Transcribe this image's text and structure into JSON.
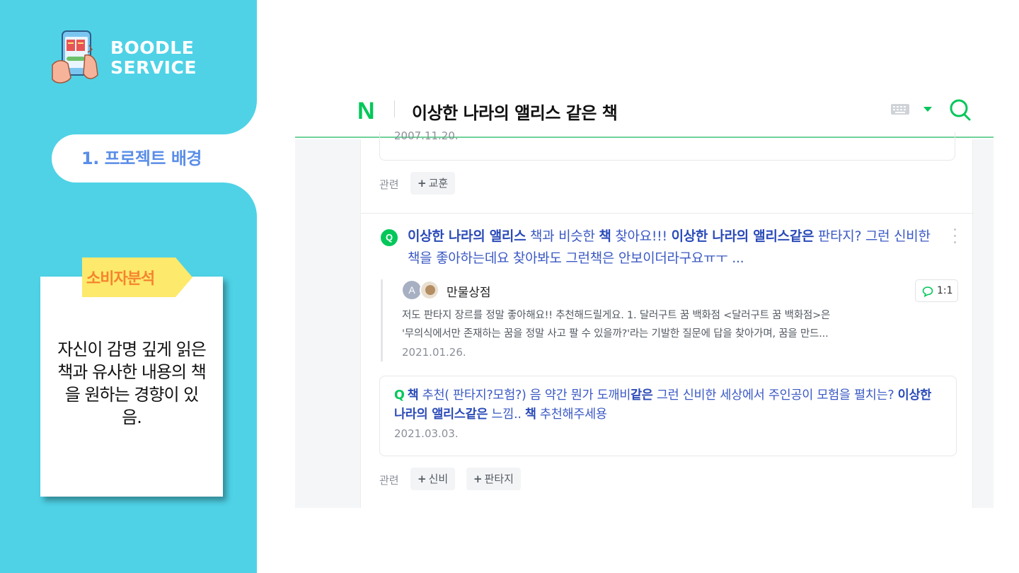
{
  "brand": {
    "line1": "BOODLE",
    "line2": "SERVICE"
  },
  "section_tab": {
    "label": "1. 프로젝트 배경"
  },
  "note": {
    "tag": "소비자분석",
    "body": "자신이 감명 깊게 읽은 책과 유사한 내용의 책을 원하는 경향이 있음."
  },
  "search": {
    "logo": "N",
    "query": "이상한 나라의 앨리스 같은 책"
  },
  "results": {
    "prev_date": "2007.11.20.",
    "related_1": {
      "label": "관련",
      "chips": [
        "교훈"
      ]
    },
    "question": {
      "badge": "Q",
      "parts": [
        {
          "text": "이상한 나라의 앨리스",
          "bold": true
        },
        {
          "text": " 책과 비슷한 ",
          "bold": false
        },
        {
          "text": "책",
          "bold": true
        },
        {
          "text": " 찾아요!!! ",
          "bold": false
        },
        {
          "text": "이상한 나라의 앨리스같은",
          "bold": true
        },
        {
          "text": " 판타지? 그런 신비한 책을 좋아하는데요 찾아봐도 그런책은 안보이더라구요ㅠㅜ ...",
          "bold": false
        }
      ]
    },
    "answer": {
      "avatar_letter": "A",
      "name": "만물상점",
      "ratio": "1:1",
      "line1": "저도 판타지 장르를 정말 좋아해요!! 추천해드릴게요. 1. 달러구트 꿈 백화점 <달러구트 꿈 백화점>은",
      "line2": "'무의식에서만 존재하는 꿈을 정말 사고 팔 수 있을까?'라는 기발한 질문에 답을 찾아가며, 꿈을 만드...",
      "date": "2021.01.26."
    },
    "sub_question": {
      "badge": "Q",
      "parts": [
        {
          "text": "책",
          "bold": true
        },
        {
          "text": " 추천( 판타지?모험?) 음 약간 뭔가 도깨비",
          "bold": false
        },
        {
          "text": "같은",
          "bold": true
        },
        {
          "text": " 그런 신비한 세상에서 주인공이 모험을 펼치는? ",
          "bold": false
        },
        {
          "text": "이상한 나라의 앨리스같은",
          "bold": true
        },
        {
          "text": " 느낌.. ",
          "bold": false
        },
        {
          "text": "책",
          "bold": true
        },
        {
          "text": " 추천해주세용",
          "bold": false
        }
      ],
      "date": "2021.03.03."
    },
    "related_2": {
      "label": "관련",
      "chips": [
        "신비",
        "판타지"
      ]
    }
  },
  "colors": {
    "panel": "#4fd2e6",
    "tab_text": "#5a8ee8",
    "tag_bg": "#fde96b",
    "tag_text": "#f5842f",
    "naver_green": "#03c75a",
    "link_blue": "#3b59c4"
  },
  "icons": {
    "logo_illustration": "phone-with-books-illustration",
    "keyboard": "keyboard-icon",
    "dropdown": "caret-down-icon",
    "search": "search-icon",
    "more": "kebab-icon",
    "comment": "speech-bubble-icon"
  }
}
